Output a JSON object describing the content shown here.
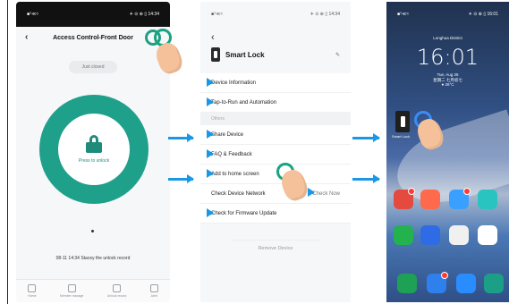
{
  "phone1": {
    "status_left": "■ᵀ≪≈",
    "status_right": "✈ ⊙ ⊕ ▯ 14:34",
    "title": "Access Control-Front Door",
    "just_closed": "Just closed",
    "press_text": "Press to unlock",
    "record_text": "08-11 14:34 Stacey the unlock record",
    "tabs": [
      "Home",
      "Member manage",
      "Unlock record",
      "Alert"
    ]
  },
  "phone2": {
    "status_left": "■ᵀ≪≈",
    "status_right": "✈ ⊙ ⊕ ▯ 14:34",
    "title": "Smart Lock",
    "menu": {
      "device_information": "Device Information",
      "tap_to_run": "Tap-to-Run and Automation",
      "section_label": "Others",
      "share_device": "Share Device",
      "faq_feedback": "FAQ & Feedback",
      "add_home": "Add to home screen",
      "check_network": "Check Device Network",
      "check_now": "Check Now",
      "firmware_update": "Check for Firmware Update"
    },
    "remove_device": "Remove Device"
  },
  "phone3": {
    "status_left": "■ᵀ≪≈",
    "status_right": "✈ ⊙ ⊕ ▯ 16:01",
    "location": "Longhua District",
    "time": "16:01",
    "date_line1": "Tue, Aug 25",
    "date_line2": "星期二 七月初七",
    "date_line3": "● 26°C",
    "widget_label": "Smart Lock",
    "badges": [
      "28",
      "",
      "24",
      "",
      "",
      "",
      "",
      "",
      "",
      "2",
      "",
      ""
    ]
  },
  "colors": {
    "teal": "#1fa08b",
    "arrow_blue": "#1a98e6"
  }
}
